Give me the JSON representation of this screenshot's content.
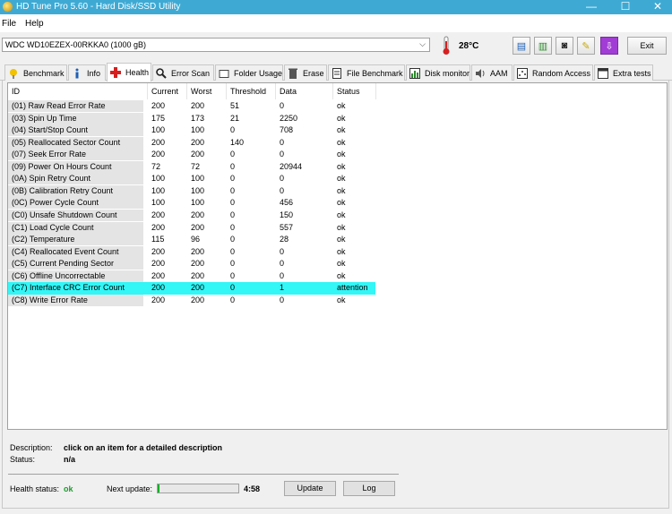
{
  "window": {
    "title": "HD Tune Pro 5.60 - Hard Disk/SSD Utility",
    "minimize": "—",
    "maximize": "☐",
    "close": "✕"
  },
  "menu": {
    "file": "File",
    "help": "Help"
  },
  "drive": {
    "selected": "WDC WD10EZEX-00RKKA0 (1000 gB)",
    "temperature": "28°C",
    "exit_label": "Exit"
  },
  "tabs": [
    {
      "label": "Benchmark",
      "icon": "gauge-icon"
    },
    {
      "label": "Info",
      "icon": "info-icon"
    },
    {
      "label": "Health",
      "icon": "health-cross-icon",
      "active": true
    },
    {
      "label": "Error Scan",
      "icon": "magnifier-icon"
    },
    {
      "label": "Folder Usage",
      "icon": "folder-icon"
    },
    {
      "label": "Erase",
      "icon": "trash-icon"
    },
    {
      "label": "File Benchmark",
      "icon": "file-benchmark-icon"
    },
    {
      "label": "Disk monitor",
      "icon": "monitor-icon"
    },
    {
      "label": "AAM",
      "icon": "speaker-icon"
    },
    {
      "label": "Random Access",
      "icon": "random-access-icon"
    },
    {
      "label": "Extra tests",
      "icon": "extra-tests-icon"
    }
  ],
  "table": {
    "headers": [
      "ID",
      "Current",
      "Worst",
      "Threshold",
      "Data",
      "Status"
    ],
    "rows": [
      {
        "id": "(01) Raw Read Error Rate",
        "current": "200",
        "worst": "200",
        "threshold": "51",
        "data": "0",
        "status": "ok"
      },
      {
        "id": "(03) Spin Up Time",
        "current": "175",
        "worst": "173",
        "threshold": "21",
        "data": "2250",
        "status": "ok"
      },
      {
        "id": "(04) Start/Stop Count",
        "current": "100",
        "worst": "100",
        "threshold": "0",
        "data": "708",
        "status": "ok"
      },
      {
        "id": "(05) Reallocated Sector Count",
        "current": "200",
        "worst": "200",
        "threshold": "140",
        "data": "0",
        "status": "ok"
      },
      {
        "id": "(07) Seek Error Rate",
        "current": "200",
        "worst": "200",
        "threshold": "0",
        "data": "0",
        "status": "ok"
      },
      {
        "id": "(09) Power On Hours Count",
        "current": "72",
        "worst": "72",
        "threshold": "0",
        "data": "20944",
        "status": "ok"
      },
      {
        "id": "(0A) Spin Retry Count",
        "current": "100",
        "worst": "100",
        "threshold": "0",
        "data": "0",
        "status": "ok"
      },
      {
        "id": "(0B) Calibration Retry Count",
        "current": "100",
        "worst": "100",
        "threshold": "0",
        "data": "0",
        "status": "ok"
      },
      {
        "id": "(0C) Power Cycle Count",
        "current": "100",
        "worst": "100",
        "threshold": "0",
        "data": "456",
        "status": "ok"
      },
      {
        "id": "(C0) Unsafe Shutdown Count",
        "current": "200",
        "worst": "200",
        "threshold": "0",
        "data": "150",
        "status": "ok"
      },
      {
        "id": "(C1) Load Cycle Count",
        "current": "200",
        "worst": "200",
        "threshold": "0",
        "data": "557",
        "status": "ok"
      },
      {
        "id": "(C2) Temperature",
        "current": "115",
        "worst": "96",
        "threshold": "0",
        "data": "28",
        "status": "ok"
      },
      {
        "id": "(C4) Reallocated Event Count",
        "current": "200",
        "worst": "200",
        "threshold": "0",
        "data": "0",
        "status": "ok"
      },
      {
        "id": "(C5) Current Pending Sector",
        "current": "200",
        "worst": "200",
        "threshold": "0",
        "data": "0",
        "status": "ok"
      },
      {
        "id": "(C6) Offline Uncorrectable",
        "current": "200",
        "worst": "200",
        "threshold": "0",
        "data": "0",
        "status": "ok"
      },
      {
        "id": "(C7) Interface CRC Error Count",
        "current": "200",
        "worst": "200",
        "threshold": "0",
        "data": "1",
        "status": "attention",
        "highlight": true
      },
      {
        "id": "(C8) Write Error Rate",
        "current": "200",
        "worst": "200",
        "threshold": "0",
        "data": "0",
        "status": "ok"
      }
    ]
  },
  "info": {
    "description_label": "Description:",
    "description_value": "click on an item for a detailed description",
    "status_label": "Status:",
    "status_value": "n/a"
  },
  "footer": {
    "health_label": "Health status:",
    "health_value": "ok",
    "next_update_label": "Next update:",
    "next_update_time": "4:58",
    "update_progress": 0.02,
    "update_button": "Update",
    "log_button": "Log"
  },
  "colors": {
    "titlebar": "#3eaad4",
    "highlight_row": "#33f6f6",
    "health_ok": "#1c9c2c"
  }
}
